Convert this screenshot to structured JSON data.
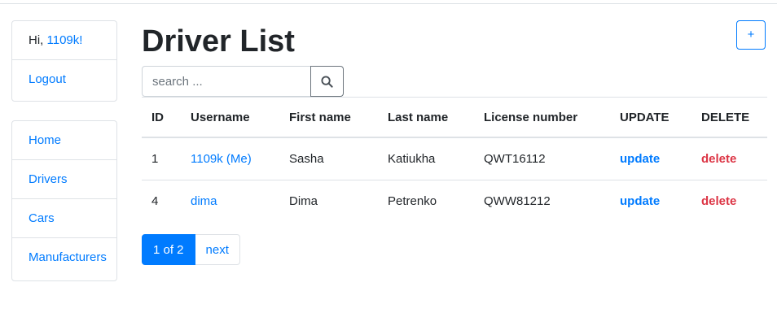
{
  "greeting": {
    "prefix": "Hi, ",
    "username": "1109k!"
  },
  "user_menu": {
    "logout": "Logout"
  },
  "nav": {
    "items": [
      {
        "label": "Home"
      },
      {
        "label": "Drivers"
      },
      {
        "label": "Cars"
      },
      {
        "label": "Manufacturers"
      }
    ]
  },
  "page": {
    "title": "Driver List"
  },
  "toolbar": {
    "add_label": "+"
  },
  "search": {
    "placeholder": "search ...",
    "value": "",
    "icon": "search-icon"
  },
  "table": {
    "headers": [
      "ID",
      "Username",
      "First name",
      "Last name",
      "License number",
      "UPDATE",
      "DELETE"
    ],
    "rows": [
      {
        "id": "1",
        "username": "1109k (Me)",
        "first_name": "Sasha",
        "last_name": "Katiukha",
        "license": "QWT16112",
        "update": "update",
        "delete": "delete"
      },
      {
        "id": "4",
        "username": "dima",
        "first_name": "Dima",
        "last_name": "Petrenko",
        "license": "QWW81212",
        "update": "update",
        "delete": "delete"
      }
    ]
  },
  "pagination": {
    "current": "1 of 2",
    "next": "next"
  },
  "colors": {
    "primary": "#007bff",
    "danger": "#dc3545",
    "text": "#212529",
    "border": "#dee2e6"
  }
}
